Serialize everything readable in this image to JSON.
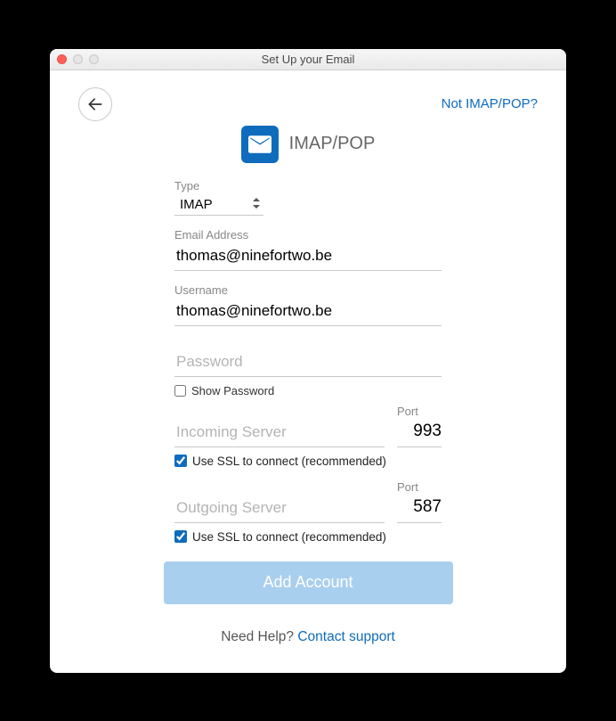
{
  "window": {
    "title": "Set Up your Email"
  },
  "top": {
    "not_imap_link": "Not IMAP/POP?"
  },
  "header": {
    "title": "IMAP/POP"
  },
  "form": {
    "type_label": "Type",
    "type_value": "IMAP",
    "email_label": "Email Address",
    "email_value": "thomas@ninefortwo.be",
    "username_label": "Username",
    "username_value": "thomas@ninefortwo.be",
    "password_placeholder": "Password",
    "password_value": "",
    "show_password_label": "Show Password",
    "show_password_checked": false,
    "incoming_placeholder": "Incoming Server",
    "incoming_value": "",
    "incoming_port_label": "Port",
    "incoming_port_value": "993",
    "incoming_ssl_label": "Use SSL to connect (recommended)",
    "incoming_ssl_checked": true,
    "outgoing_placeholder": "Outgoing Server",
    "outgoing_value": "",
    "outgoing_port_label": "Port",
    "outgoing_port_value": "587",
    "outgoing_ssl_label": "Use SSL to connect (recommended)",
    "outgoing_ssl_checked": true,
    "add_button_label": "Add Account"
  },
  "footer": {
    "help_text": "Need Help? ",
    "contact_link": "Contact support"
  }
}
